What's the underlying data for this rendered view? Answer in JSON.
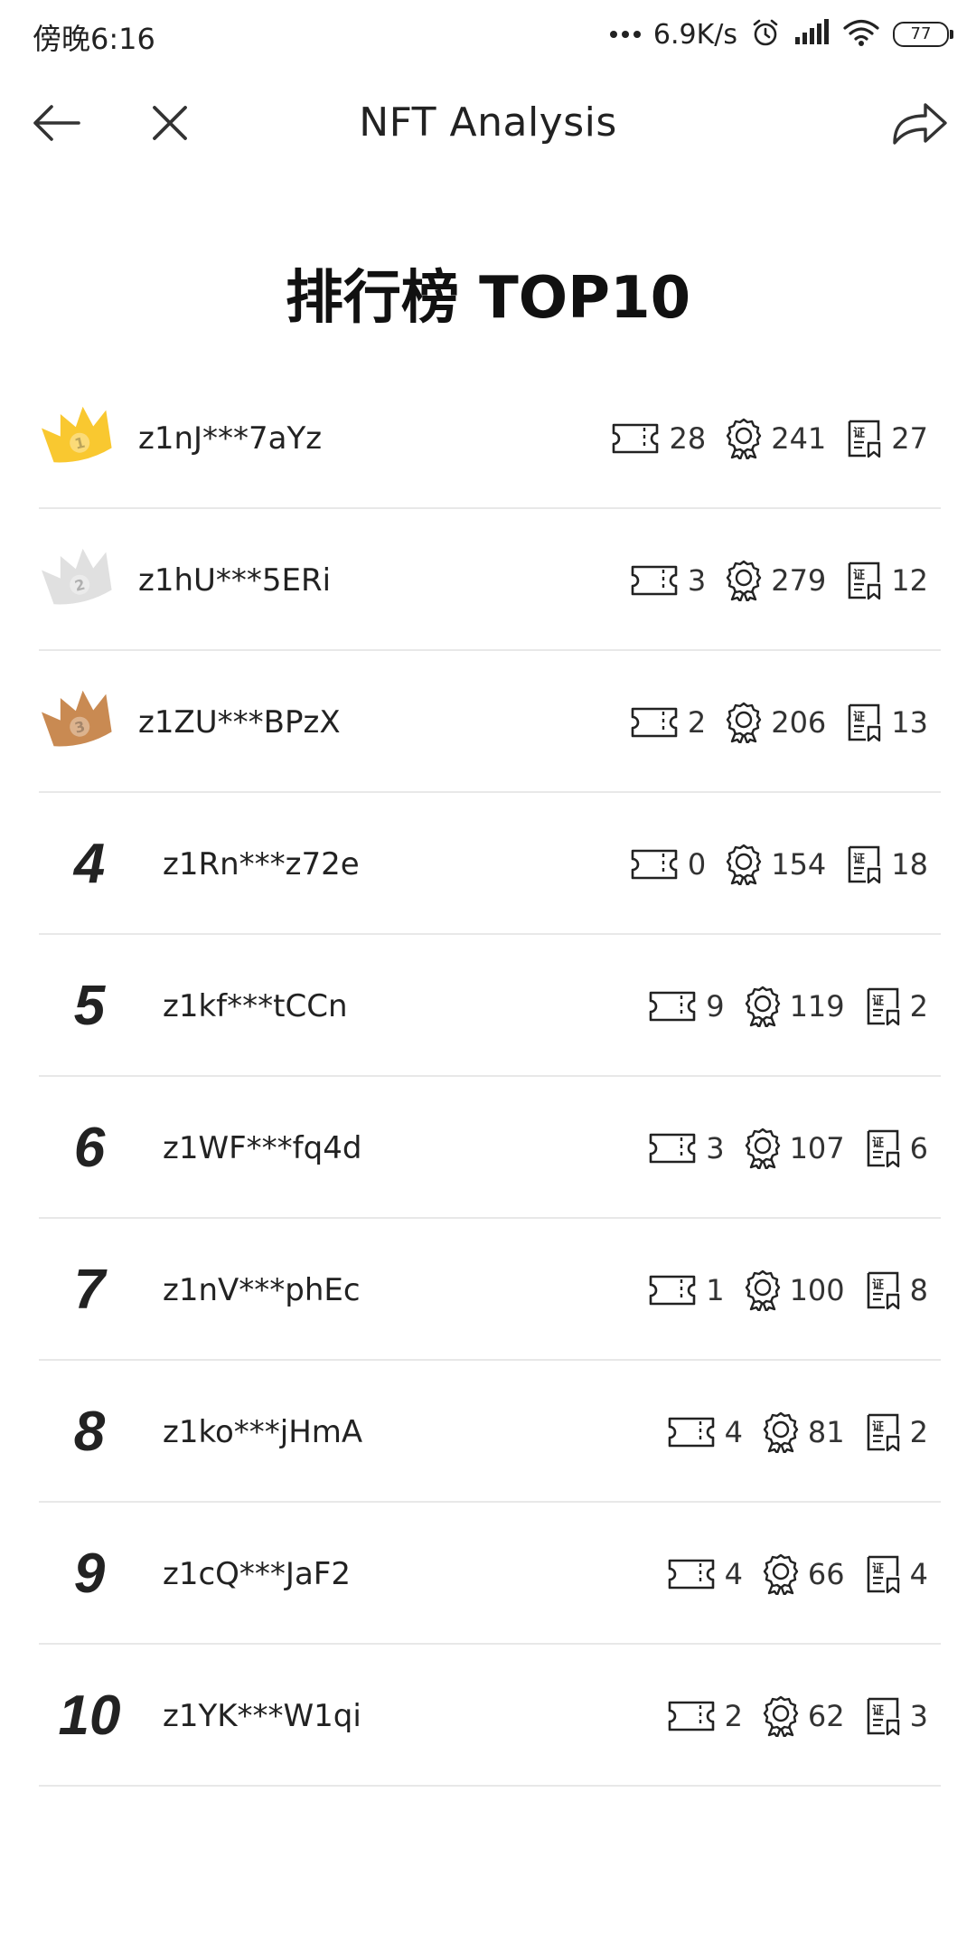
{
  "status_bar": {
    "time": "傍晚6:16",
    "speed": "6.9K/s",
    "battery": "77"
  },
  "nav": {
    "title": "NFT Analysis",
    "icons": [
      "back-arrow-icon",
      "close-icon",
      "share-icon"
    ]
  },
  "heading": "排行榜 TOP10",
  "crown_colors": {
    "gold": "#F9C830",
    "silver": "#E0E0E0",
    "bronze": "#C98A52"
  },
  "stat_icons": [
    "ticket-icon",
    "medal-icon",
    "certificate-icon"
  ],
  "leaderboard": [
    {
      "rank": "1",
      "name": "z1nJ***7aYz",
      "tickets": "28",
      "medals": "241",
      "certs": "27"
    },
    {
      "rank": "2",
      "name": "z1hU***5ERi",
      "tickets": "3",
      "medals": "279",
      "certs": "12"
    },
    {
      "rank": "3",
      "name": "z1ZU***BPzX",
      "tickets": "2",
      "medals": "206",
      "certs": "13"
    },
    {
      "rank": "4",
      "name": "z1Rn***z72e",
      "tickets": "0",
      "medals": "154",
      "certs": "18"
    },
    {
      "rank": "5",
      "name": "z1kf***tCCn",
      "tickets": "9",
      "medals": "119",
      "certs": "2"
    },
    {
      "rank": "6",
      "name": "z1WF***fq4d",
      "tickets": "3",
      "medals": "107",
      "certs": "6"
    },
    {
      "rank": "7",
      "name": "z1nV***phEc",
      "tickets": "1",
      "medals": "100",
      "certs": "8"
    },
    {
      "rank": "8",
      "name": "z1ko***jHmA",
      "tickets": "4",
      "medals": "81",
      "certs": "2"
    },
    {
      "rank": "9",
      "name": "z1cQ***JaF2",
      "tickets": "4",
      "medals": "66",
      "certs": "4"
    },
    {
      "rank": "10",
      "name": "z1YK***W1qi",
      "tickets": "2",
      "medals": "62",
      "certs": "3"
    }
  ]
}
